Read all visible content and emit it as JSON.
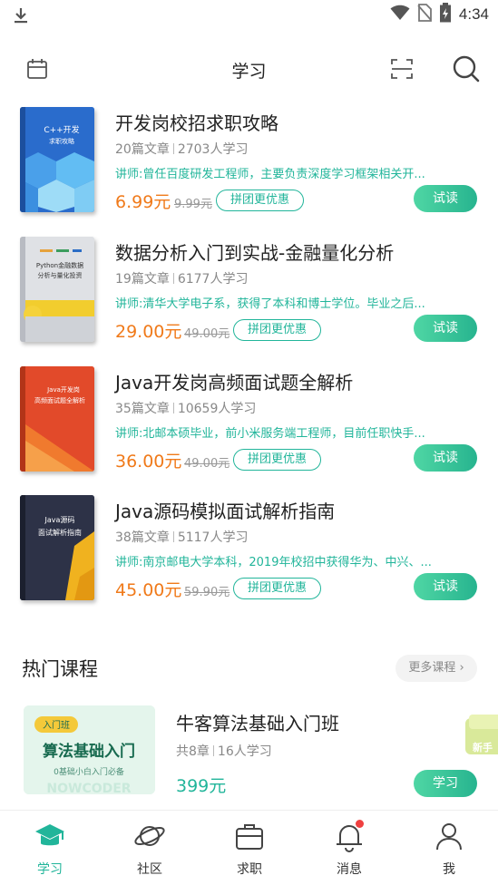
{
  "status_bar": {
    "time": "4:34"
  },
  "header": {
    "title": "学习"
  },
  "courses": [
    {
      "title": "开发岗校招求职攻略",
      "articles": "20篇文章",
      "learners": "2703人学习",
      "teacher": "讲师:曾任百度研发工程师，主要负责深度学习框架相关开...",
      "price": "6.99元",
      "original_price": "9.99元",
      "group_label": "拼团更优惠",
      "try_label": "试读",
      "cover": {
        "line1": "C++开发",
        "line2": "求职攻略"
      }
    },
    {
      "title": "数据分析入门到实战-金融量化分析",
      "articles": "19篇文章",
      "learners": "6177人学习",
      "teacher": "讲师:清华大学电子系，获得了本科和博士学位。毕业之后...",
      "price": "29.00元",
      "original_price": "49.00元",
      "group_label": "拼团更优惠",
      "try_label": "试读",
      "cover": {
        "line1": "Python金融数据",
        "line2": "分析与量化投资"
      }
    },
    {
      "title": "Java开发岗高频面试题全解析",
      "articles": "35篇文章",
      "learners": "10659人学习",
      "teacher": "讲师:北邮本硕毕业，前小米服务端工程师，目前任职快手...",
      "price": "36.00元",
      "original_price": "49.00元",
      "group_label": "拼团更优惠",
      "try_label": "试读",
      "cover": {
        "line1": "Java开发岗",
        "line2": "高频面试题全解析"
      }
    },
    {
      "title": "Java源码模拟面试解析指南",
      "articles": "38篇文章",
      "learners": "5117人学习",
      "teacher": "讲师:南京邮电大学本科，2019年校招中获得华为、中兴、...",
      "price": "45.00元",
      "original_price": "59.90元",
      "group_label": "拼团更优惠",
      "try_label": "试读",
      "cover": {
        "line1": "Java源码",
        "line2": "面试解析指南"
      }
    }
  ],
  "hot": {
    "section_title": "热门课程",
    "more_label": "更多课程",
    "course": {
      "title": "牛客算法基础入门班",
      "chapters": "共8章",
      "learners": "16人学习",
      "price": "399元",
      "learn_label": "学习",
      "cover": {
        "tag": "入门班",
        "main": "算法基础入门",
        "sub": "0基础小白入门必备",
        "brand": "NOWCODER"
      },
      "corner_badge": "新手"
    }
  },
  "nav": [
    {
      "label": "学习",
      "icon": "graduation-cap-icon",
      "active": true
    },
    {
      "label": "社区",
      "icon": "planet-icon",
      "active": false
    },
    {
      "label": "求职",
      "icon": "briefcase-icon",
      "active": false
    },
    {
      "label": "消息",
      "icon": "bell-icon",
      "active": false
    },
    {
      "label": "我",
      "icon": "person-icon",
      "active": false
    }
  ],
  "colors": {
    "accent": "#21b59a",
    "price": "#f07a1a",
    "notification": "#f04040"
  }
}
